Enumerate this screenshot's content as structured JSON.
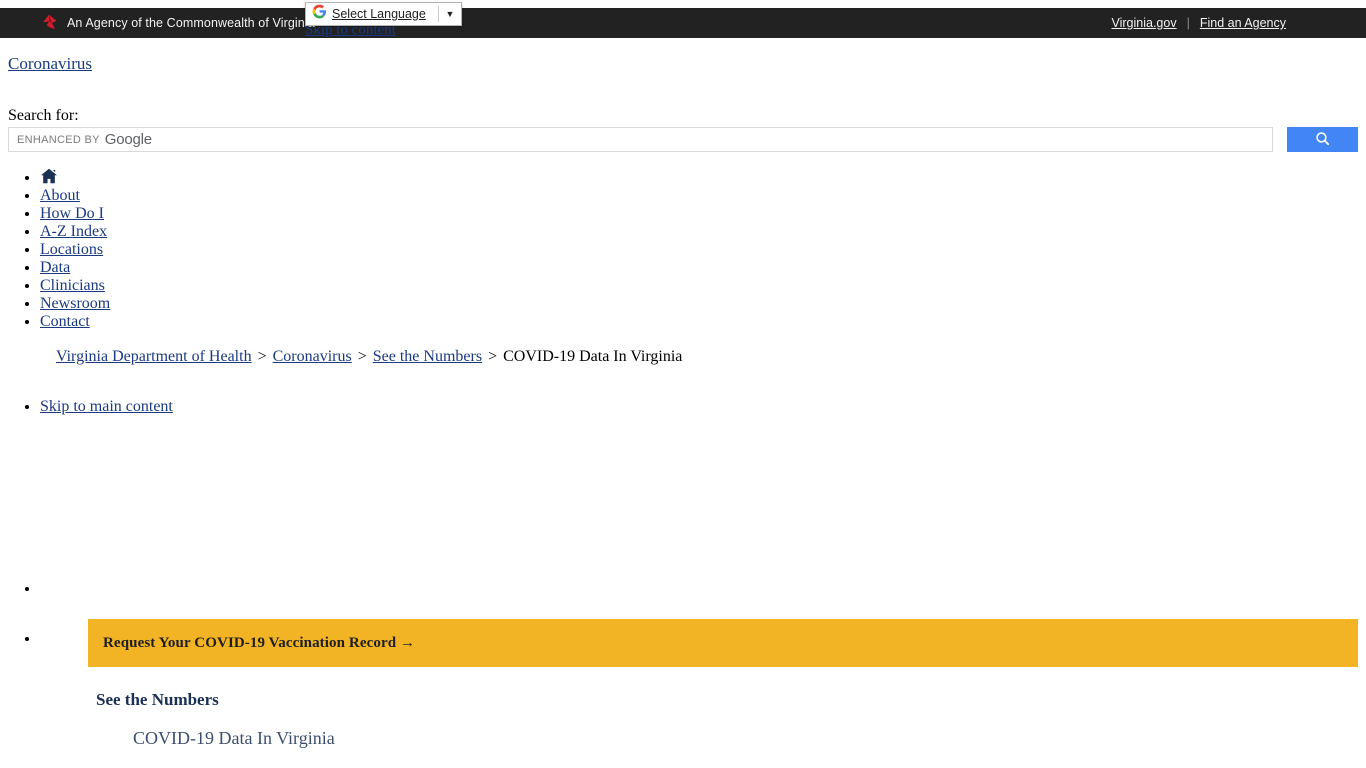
{
  "gov_bar": {
    "agency_text": "An Agency of the Commonwealth of Virginia",
    "logo_icon": "virginia-seal-icon",
    "links": [
      {
        "label": "Virginia.gov"
      },
      {
        "label": "Find an Agency"
      }
    ],
    "separator": "|"
  },
  "translate_widget": {
    "logo_icon": "google-g-icon",
    "label": "Select Language",
    "caret": "▼"
  },
  "skip_to_content": "Skip to content",
  "corona_link": "Coronavirus",
  "search": {
    "label": "Search for:",
    "enhanced_by": "ENHANCED BY",
    "brand": "Google",
    "placeholder": "",
    "value": "",
    "button_icon": "search-icon"
  },
  "main_nav": {
    "items": [
      {
        "label": "",
        "icon": "home-icon"
      },
      {
        "label": "About",
        "icon": ""
      },
      {
        "label": "How Do I",
        "icon": ""
      },
      {
        "label": "A-Z Index",
        "icon": ""
      },
      {
        "label": "Locations",
        "icon": ""
      },
      {
        "label": "Data",
        "icon": ""
      },
      {
        "label": "Clinicians",
        "icon": ""
      },
      {
        "label": "Newsroom",
        "icon": ""
      },
      {
        "label": "Contact",
        "icon": ""
      }
    ]
  },
  "breadcrumb": {
    "separator": ">",
    "items": [
      {
        "label": "Virginia Department of Health",
        "link": true
      },
      {
        "label": "Coronavirus",
        "link": true
      },
      {
        "label": "See the Numbers",
        "link": true
      },
      {
        "label": "COVID-19 Data In Virginia",
        "link": false
      }
    ]
  },
  "skip_main": "Skip to main content",
  "promo": {
    "banner_text": "Request Your COVID-19 Vaccination Record →",
    "banner_color": "#f2b325"
  },
  "content": {
    "section_title": "See the Numbers",
    "page_title": "COVID-19 Data In Virginia"
  },
  "colors": {
    "topbar": "#222222",
    "link": "#1b3a82",
    "accent_yellow": "#f2b325",
    "google_blue": "#4285f4",
    "navy": "#1b3055"
  }
}
